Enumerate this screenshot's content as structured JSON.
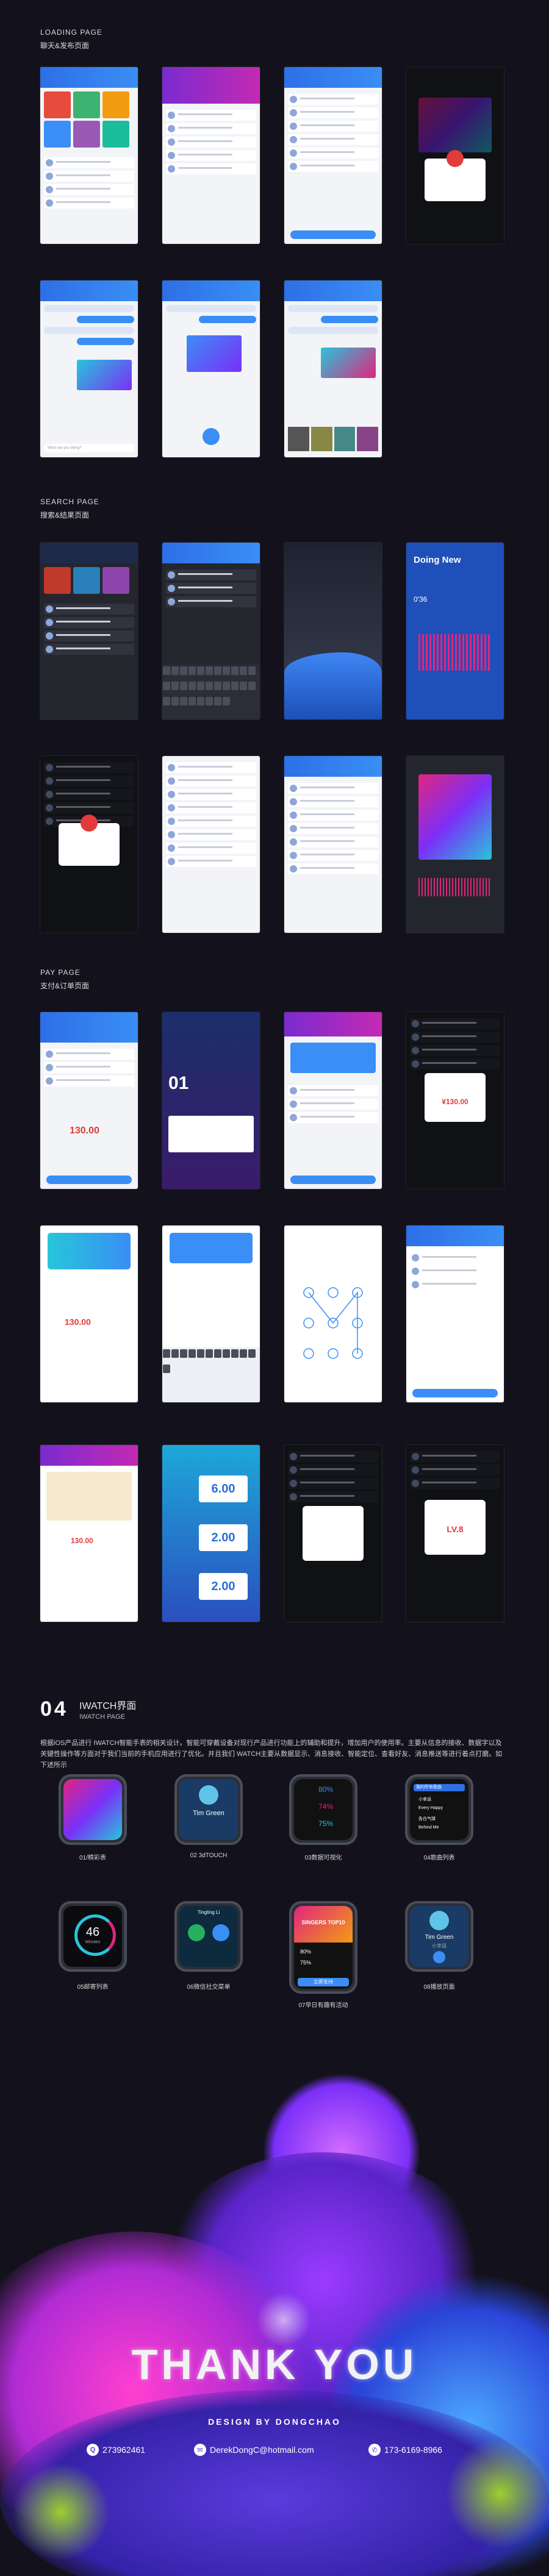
{
  "sections": {
    "loading": {
      "title": "LOADING PAGE",
      "subtitle": "聊天&发布页面"
    },
    "search": {
      "title": "SEARCH PAGE",
      "subtitle": "搜索&结果页面"
    },
    "pay": {
      "title": "PAY PAGE",
      "subtitle": "支付&订单页面"
    }
  },
  "screens": {
    "doing_new": "Doing New",
    "doing_time": "0'36",
    "date_num": "01",
    "price_1": "¥130.00",
    "price_2": "130.00",
    "level": "LV.8",
    "gift_1": "6.00",
    "gift_2": "2.00",
    "gift_3": "2.00",
    "input_placeholder": "What are you doing?"
  },
  "watch": {
    "number": "04",
    "title": "IWATCH界面",
    "subtitle": "IWATCH PAGE",
    "description": "根据iOS产品进行 IWATCH智能手表的相关设计。智能可穿戴设备对现行产品进行功能上的辅助和提升，增加用户的使用率。主要从信息的接收、数据字以及关键性操作等方面对于我们当前的手机应用进行了优化。并且我们 WATCH主要从数据显示、消息接收、智能定位、查看好友、消息推送等进行着点打磨。如下述所示",
    "screens": [
      {
        "caption": "01/精彩表",
        "time": "10:42",
        "label": "精彩表"
      },
      {
        "caption": "02 3dTOUCH",
        "time": "10:42",
        "name": "Tim Green"
      },
      {
        "caption": "03数据可视化",
        "time": "10:42",
        "v1": "80%",
        "v2": "74%",
        "v3": "75%"
      },
      {
        "caption": "04歌曲列表",
        "time": "10:42",
        "items": [
          "我的所有歌曲",
          "小幸运",
          "Every Happy",
          "告白气球",
          "Behind Me"
        ]
      },
      {
        "caption": "05邮寄列表",
        "time": "10:42",
        "value": "46",
        "unit": "Minutes"
      },
      {
        "caption": "06微信社交菜单",
        "time": "10:42",
        "name": "Tingting Li"
      },
      {
        "caption": "07早日有趣有活动",
        "time": "10:42",
        "banner": "SINGERS TOP10",
        "v1": "80%",
        "v2": "75%",
        "cta": "立即支持"
      },
      {
        "caption": "08播放页面",
        "time": "10:42",
        "name": "Tim Green",
        "artist": "小幸运"
      }
    ]
  },
  "footer": {
    "thanks": "THANK  YOU",
    "design": "DESIGN BY DONGCHAO",
    "qq": "273962461",
    "email": "DerekDongC@hotmail.com",
    "phone": "173-6169-8966"
  },
  "colors": {
    "accent_blue": "#3a8ef5",
    "accent_purple": "#7a2bd0",
    "accent_pink": "#e0257f",
    "bg": "#13121c"
  }
}
